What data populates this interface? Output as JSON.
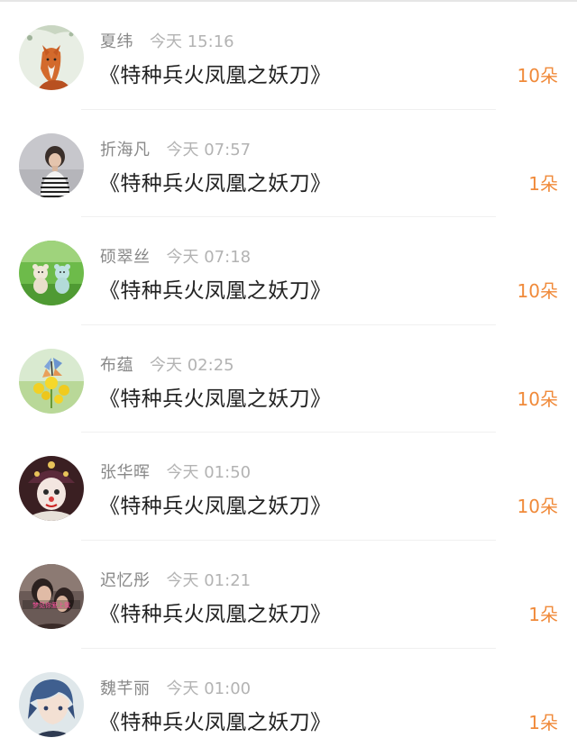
{
  "colors": {
    "name": "#888888",
    "time": "#b3b3b3",
    "title": "#222222",
    "gift": "#f08a3a",
    "divider": "#f0f0f0"
  },
  "rows": [
    {
      "name": "夏纬",
      "time": "今天 15:16",
      "title": "《特种兵火凤凰之妖刀》",
      "gift": "10朵",
      "avatar_icon": "fox-avatar-icon"
    },
    {
      "name": "折海凡",
      "time": "今天 07:57",
      "title": "《特种兵火凤凰之妖刀》",
      "gift": "1朵",
      "avatar_icon": "boy-avatar-icon"
    },
    {
      "name": "硕翠丝",
      "time": "今天 07:18",
      "title": "《特种兵火凤凰之妖刀》",
      "gift": "10朵",
      "avatar_icon": "teddy-bears-avatar-icon"
    },
    {
      "name": "布蕴",
      "time": "今天 02:25",
      "title": "《特种兵火凤凰之妖刀》",
      "gift": "10朵",
      "avatar_icon": "butterfly-avatar-icon"
    },
    {
      "name": "张华晖",
      "time": "今天 01:50",
      "title": "《特种兵火凤凰之妖刀》",
      "gift": "10朵",
      "avatar_icon": "clown-avatar-icon"
    },
    {
      "name": "迟忆彤",
      "time": "今天 01:21",
      "title": "《特种兵火凤凰之妖刀》",
      "gift": "1朵",
      "avatar_icon": "couple-avatar-icon",
      "avatar_text": "梦见你爱上我"
    },
    {
      "name": "魏芊丽",
      "time": "今天 01:00",
      "title": "《特种兵火凤凰之妖刀》",
      "gift": "1朵",
      "avatar_icon": "anime-boy-avatar-icon"
    }
  ]
}
